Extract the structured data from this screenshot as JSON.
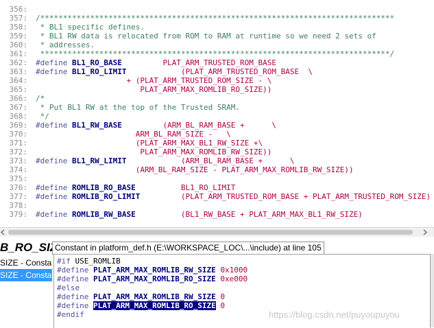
{
  "editor": {
    "lines": [
      {
        "n": "356:",
        "parts": []
      },
      {
        "n": "357:",
        "parts": [
          {
            "t": "/******************************************************************************",
            "c": "c"
          }
        ]
      },
      {
        "n": "358:",
        "parts": [
          {
            "t": " * BL1 specific defines.",
            "c": "c"
          }
        ]
      },
      {
        "n": "359:",
        "parts": [
          {
            "t": " * BL1 RW data is relocated from ROM to RAM at runtime so we need 2 sets of",
            "c": "c"
          }
        ]
      },
      {
        "n": "360:",
        "parts": [
          {
            "t": " * addresses.",
            "c": "c"
          }
        ]
      },
      {
        "n": "361:",
        "parts": [
          {
            "t": " *****************************************************************************/",
            "c": "c"
          }
        ]
      },
      {
        "n": "362:",
        "parts": [
          {
            "t": "#define ",
            "c": "kw"
          },
          {
            "t": "BL1_RO_BASE",
            "c": "id"
          },
          {
            "t": "         PLAT_ARM_TRUSTED_ROM_BASE",
            "c": "mac"
          }
        ]
      },
      {
        "n": "363:",
        "parts": [
          {
            "t": "#define ",
            "c": "kw"
          },
          {
            "t": "BL1_RO_LIMIT",
            "c": "id"
          },
          {
            "t": "            (PLAT_ARM_TRUSTED_ROM_BASE  \\",
            "c": "mac"
          }
        ]
      },
      {
        "n": "364:",
        "parts": [
          {
            "t": "                    + (PLAT_ARM_TRUSTED_ROM_SIZE - \\",
            "c": "mac"
          }
        ]
      },
      {
        "n": "365:",
        "parts": [
          {
            "t": "                       PLAT_ARM_MAX_ROMLIB_RO_SIZE))",
            "c": "mac"
          }
        ]
      },
      {
        "n": "366:",
        "parts": [
          {
            "t": "/*",
            "c": "c"
          }
        ]
      },
      {
        "n": "367:",
        "parts": [
          {
            "t": " * Put BL1 RW at the top of the Trusted SRAM.",
            "c": "c"
          }
        ]
      },
      {
        "n": "368:",
        "parts": [
          {
            "t": " */",
            "c": "c"
          }
        ]
      },
      {
        "n": "369:",
        "parts": [
          {
            "t": "#define ",
            "c": "kw"
          },
          {
            "t": "BL1_RW_BASE",
            "c": "id"
          },
          {
            "t": "         (ARM_BL_RAM_BASE +      \\",
            "c": "mac"
          }
        ]
      },
      {
        "n": "370:",
        "parts": [
          {
            "t": "                      ARM_BL_RAM_SIZE -   \\",
            "c": "mac"
          }
        ]
      },
      {
        "n": "371:",
        "parts": [
          {
            "t": "                      (PLAT_ARM_MAX_BL1_RW_SIZE +\\",
            "c": "mac"
          }
        ]
      },
      {
        "n": "372:",
        "parts": [
          {
            "t": "                       PLAT_ARM_MAX_ROMLIB_RW_SIZE))",
            "c": "mac"
          }
        ]
      },
      {
        "n": "373:",
        "parts": [
          {
            "t": "#define ",
            "c": "kw"
          },
          {
            "t": "BL1_RW_LIMIT",
            "c": "id"
          },
          {
            "t": "            (ARM_BL_RAM_BASE +      \\",
            "c": "mac"
          }
        ]
      },
      {
        "n": "374:",
        "parts": [
          {
            "t": "                      (ARM_BL_RAM_SIZE - PLAT_ARM_MAX_ROMLIB_RW_SIZE))",
            "c": "mac"
          }
        ]
      },
      {
        "n": "375:",
        "parts": []
      },
      {
        "n": "376:",
        "parts": [
          {
            "t": "#define ",
            "c": "kw"
          },
          {
            "t": "ROMLIB_RO_BASE",
            "c": "id"
          },
          {
            "t": "          BL1_RO_LIMIT",
            "c": "mac"
          }
        ]
      },
      {
        "n": "377:",
        "parts": [
          {
            "t": "#define ",
            "c": "kw"
          },
          {
            "t": "ROMLIB_RO_LIMIT",
            "c": "id"
          },
          {
            "t": "         (PLAT_ARM_TRUSTED_ROM_BASE + PLAT_ARM_TRUSTED_ROM_SIZE)",
            "c": "mac"
          }
        ]
      },
      {
        "n": "378:",
        "parts": []
      },
      {
        "n": "379:",
        "parts": [
          {
            "t": "#define ",
            "c": "kw"
          },
          {
            "t": "ROMLIB_RW_BASE",
            "c": "id"
          },
          {
            "t": "          (BL1_RW_BASE + PLAT_ARM_MAX_BL1_RW_SIZE)",
            "c": "mac"
          }
        ]
      }
    ]
  },
  "outline": {
    "name": "B_RO_SIZE",
    "items": [
      "SIZE - Consta",
      "SIZE - Consta"
    ],
    "selected_index": 1
  },
  "tooltip": {
    "title": "Constant in platform_def.h (E:\\WORKSPACE_LOC\\...\\include) at line 105"
  },
  "hover": {
    "lines": [
      [
        {
          "t": "#if ",
          "c": "pp"
        },
        {
          "t": "USE_ROMLIB",
          "c": "plain"
        }
      ],
      [
        {
          "t": "#define ",
          "c": "pp"
        },
        {
          "t": "PLAT_ARM_MAX_ROMLIB_RW_SIZE",
          "c": "id"
        },
        {
          "t": " 0x1000",
          "c": "num"
        }
      ],
      [
        {
          "t": "#define ",
          "c": "pp"
        },
        {
          "t": "PLAT_ARM_MAX_ROMLIB_RO_SIZE",
          "c": "id"
        },
        {
          "t": " 0xe000",
          "c": "num"
        }
      ],
      [
        {
          "t": "#else",
          "c": "pp"
        }
      ],
      [
        {
          "t": "#define ",
          "c": "pp"
        },
        {
          "t": "PLAT_ARM_MAX_ROMLIB_RW_SIZE",
          "c": "id"
        },
        {
          "t": " 0",
          "c": "num"
        }
      ],
      [
        {
          "t": "#define ",
          "c": "pp"
        },
        {
          "t": "PLAT_ARM_MAX_ROMLIB_RO_SIZE",
          "c": "hl"
        },
        {
          "t": " 0",
          "c": "num"
        }
      ],
      [
        {
          "t": "#endif",
          "c": "pp"
        }
      ]
    ]
  },
  "watermark": "https://blog.csdn.net/puyoupuyou"
}
